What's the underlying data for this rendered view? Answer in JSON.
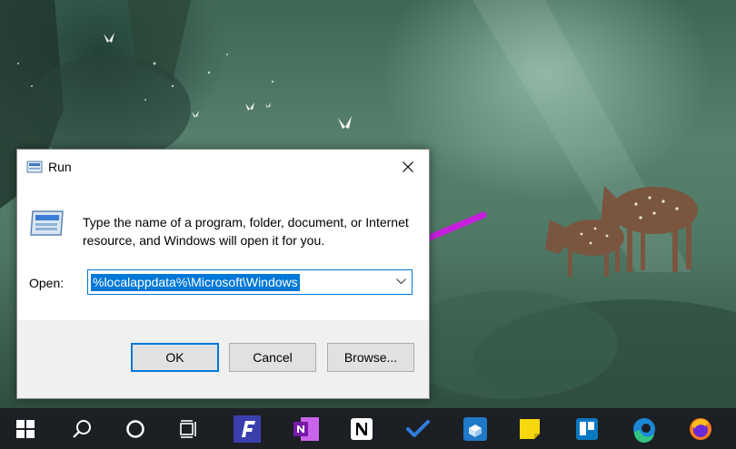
{
  "run_dialog": {
    "title": "Run",
    "description": "Type the name of a program, folder, document, or Internet resource, and Windows will open it for you.",
    "open_label": "Open:",
    "open_value": "%localappdata%\\Microsoft\\Windows",
    "buttons": {
      "ok": "OK",
      "cancel": "Cancel",
      "browse": "Browse..."
    }
  },
  "taskbar": {
    "items": [
      {
        "icon": "windows-start-icon"
      },
      {
        "icon": "search-icon"
      },
      {
        "icon": "cortana-icon"
      },
      {
        "icon": "task-view-icon"
      },
      {
        "icon": "fsviewer-icon"
      },
      {
        "icon": "onenote-icon"
      },
      {
        "icon": "notion-icon"
      },
      {
        "icon": "todo-icon"
      },
      {
        "icon": "store-icon"
      },
      {
        "icon": "sticky-notes-icon"
      },
      {
        "icon": "trello-icon"
      },
      {
        "icon": "edge-icon"
      },
      {
        "icon": "firefox-icon"
      }
    ]
  },
  "colors": {
    "accent": "#0078d7",
    "annotation_arrow": "#c51fdc",
    "taskbar": "#1c1f24"
  }
}
